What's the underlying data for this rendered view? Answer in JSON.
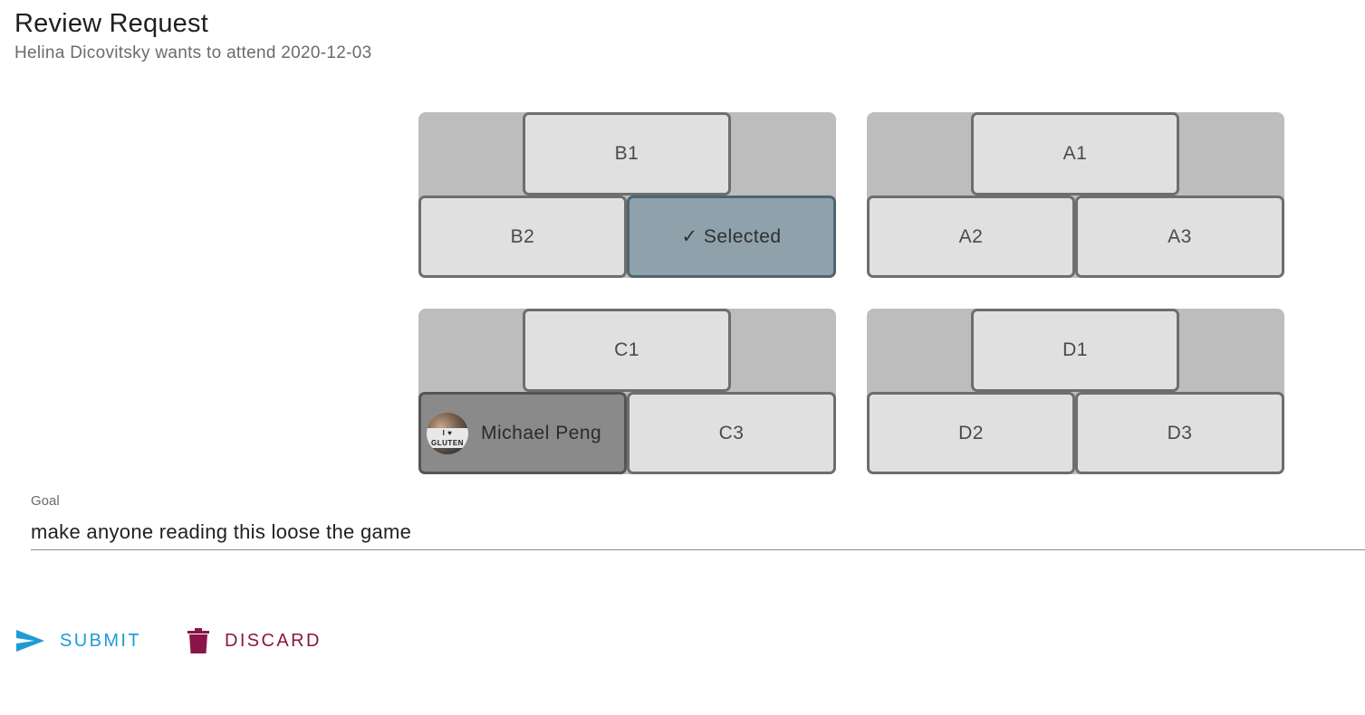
{
  "header": {
    "title": "Review Request",
    "subtitle": "Helina Dicovitsky wants to attend 2020-12-03"
  },
  "pods": {
    "B": {
      "top": "B1",
      "bottom_left": "B2",
      "bottom_right": "✓ Selected"
    },
    "A": {
      "top": "A1",
      "bottom_left": "A2",
      "bottom_right": "A3"
    },
    "C": {
      "top": "C1",
      "bottom_left": "Michael Peng",
      "bottom_right": "C3",
      "avatar_text": "I ♥ GLUTEN"
    },
    "D": {
      "top": "D1",
      "bottom_left": "D2",
      "bottom_right": "D3"
    }
  },
  "goal": {
    "label": "Goal",
    "value": "make anyone reading this loose the game"
  },
  "actions": {
    "submit_label": "SUBMIT",
    "discard_label": "DISCARD"
  },
  "colors": {
    "submit": "#1e9bd7",
    "discard": "#8a1549",
    "selected_seat": "#8fa2ab",
    "occupied_seat": "#8a8a8a",
    "pod_background": "#bdbdbd"
  },
  "icons": {
    "submit": "send-icon",
    "discard": "trash-icon"
  }
}
